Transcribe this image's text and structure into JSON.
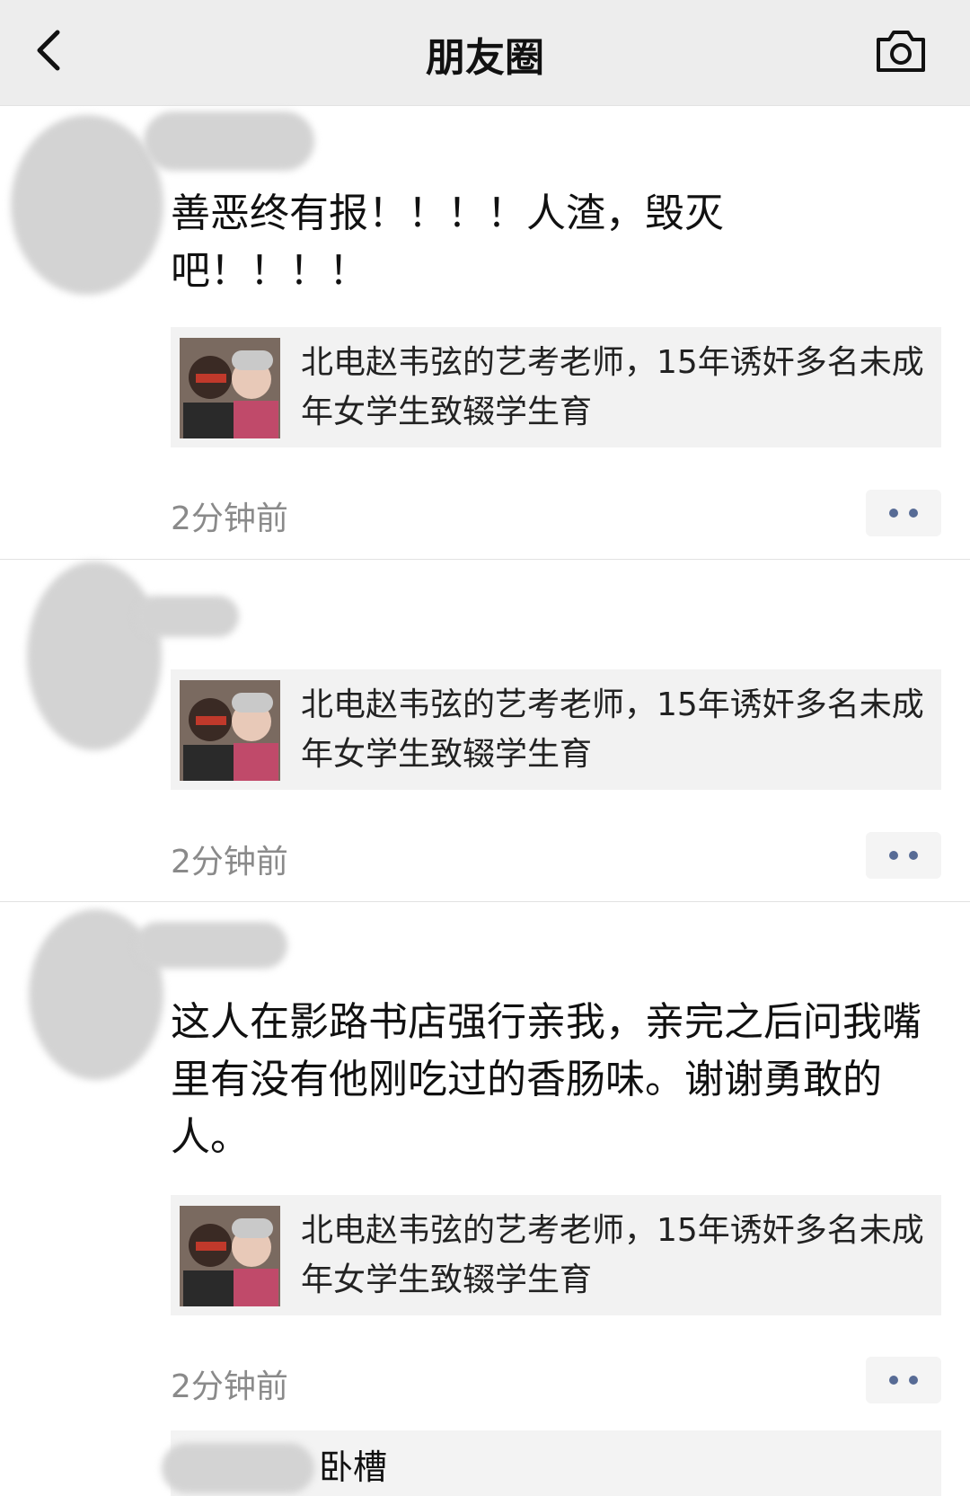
{
  "header": {
    "title": "朋友圈",
    "back_icon": "chevron-left-icon",
    "camera_icon": "camera-icon"
  },
  "posts": [
    {
      "text": "善恶终有报！！！！人渣，毁灭吧！！！！",
      "link_card": {
        "title": "北电赵韦弦的艺考老师，15年诱奸多名未成年女学生致辍学生育"
      },
      "time": "2分钟前"
    },
    {
      "text": "",
      "link_card": {
        "title": "北电赵韦弦的艺考老师，15年诱奸多名未成年女学生致辍学生育"
      },
      "time": "2分钟前"
    },
    {
      "text": "这人在影路书店强行亲我，亲完之后问我嘴里有没有他刚吃过的香肠味。谢谢勇敢的人。",
      "link_card": {
        "title": "北电赵韦弦的艺考老师，15年诱奸多名未成年女学生致辍学生育"
      },
      "time": "2分钟前"
    }
  ],
  "comment": {
    "text": "卧槽"
  },
  "colors": {
    "navbar_bg": "#ededed",
    "link_blue": "#576b95",
    "card_bg": "#f2f2f2",
    "time_gray": "#8a8a8a"
  }
}
